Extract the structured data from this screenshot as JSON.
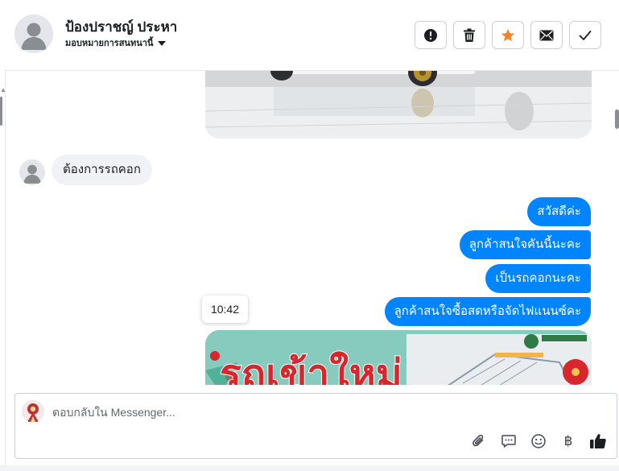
{
  "header": {
    "contact_name": "ป้องปราชญ์ ประหา",
    "assign_label": "มอบหมายการสนทนานี้",
    "actions": [
      {
        "icon": "alert-icon",
        "label": "spam"
      },
      {
        "icon": "trash-icon",
        "label": "delete"
      },
      {
        "icon": "star-icon",
        "label": "star"
      },
      {
        "icon": "envelope-icon",
        "label": "mark-unread"
      },
      {
        "icon": "check-icon",
        "label": "done"
      }
    ],
    "star_color": "#f5822a"
  },
  "conversation": {
    "incoming": [
      {
        "text": "ต้องการรถคอก"
      }
    ],
    "outgoing": [
      {
        "text": "สวัสดีค่ะ"
      },
      {
        "text": "ลูกค้าสนใจคันนี้นะคะ"
      },
      {
        "text": "เป็นรถคอกนะคะ"
      },
      {
        "text": "ลูกค้าสนใจซื้อสดหรือจัดไฟแนนซ์คะ"
      }
    ],
    "timestamp_tooltip": "10:42",
    "promo_image_text": "รถเข้าใหม่",
    "outgoing_color": "#0084ff",
    "incoming_color": "#f0f2f5"
  },
  "composer": {
    "placeholder": "ตอบกลับใน Messenger...",
    "tools": [
      "paperclip-icon",
      "speech-bubble-icon",
      "smiley-icon",
      "baht-icon",
      "thumbs-up-icon"
    ],
    "currency_symbol": "฿"
  }
}
